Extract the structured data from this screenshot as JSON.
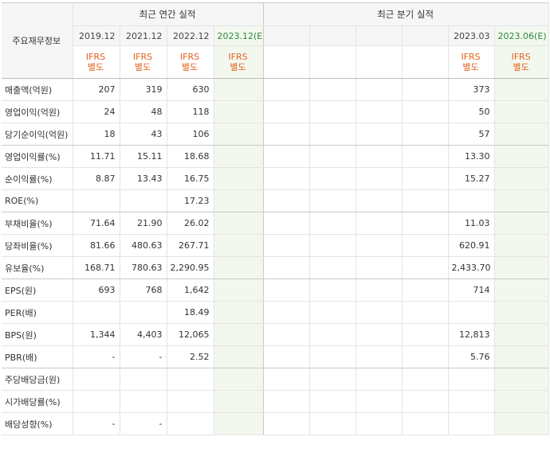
{
  "header": {
    "corner_label": "주요재무정보",
    "annual_title": "최근 연간 실적",
    "quarter_title": "최근 분기 실적",
    "annual_periods": [
      {
        "period": "2019.12",
        "basis_line1": "IFRS",
        "basis_line2": "별도"
      },
      {
        "period": "2021.12",
        "basis_line1": "IFRS",
        "basis_line2": "별도"
      },
      {
        "period": "2022.12",
        "basis_line1": "IFRS",
        "basis_line2": "별도"
      },
      {
        "period": "2023.12(E)",
        "basis_line1": "IFRS",
        "basis_line2": "별도"
      }
    ],
    "quarter_periods": [
      {
        "period": "",
        "basis_line1": "",
        "basis_line2": ""
      },
      {
        "period": "",
        "basis_line1": "",
        "basis_line2": ""
      },
      {
        "period": "",
        "basis_line1": "",
        "basis_line2": ""
      },
      {
        "period": "",
        "basis_line1": "",
        "basis_line2": ""
      },
      {
        "period": "2023.03",
        "basis_line1": "IFRS",
        "basis_line2": "별도"
      },
      {
        "period": "2023.06(E)",
        "basis_line1": "IFRS",
        "basis_line2": "별도"
      }
    ]
  },
  "rows": [
    {
      "label": "매출액(억원)",
      "annual": [
        "207",
        "319",
        "630",
        ""
      ],
      "quarter": [
        "",
        "",
        "",
        "",
        "373",
        ""
      ]
    },
    {
      "label": "영업이익(억원)",
      "annual": [
        "24",
        "48",
        "118",
        ""
      ],
      "quarter": [
        "",
        "",
        "",
        "",
        "50",
        ""
      ]
    },
    {
      "label": "당기순이익(억원)",
      "annual": [
        "18",
        "43",
        "106",
        ""
      ],
      "quarter": [
        "",
        "",
        "",
        "",
        "57",
        ""
      ]
    },
    {
      "label": "영업이익률(%)",
      "annual": [
        "11.71",
        "15.11",
        "18.68",
        ""
      ],
      "quarter": [
        "",
        "",
        "",
        "",
        "13.30",
        ""
      ]
    },
    {
      "label": "순이익률(%)",
      "annual": [
        "8.87",
        "13.43",
        "16.75",
        ""
      ],
      "quarter": [
        "",
        "",
        "",
        "",
        "15.27",
        ""
      ]
    },
    {
      "label": "ROE(%)",
      "annual": [
        "",
        "",
        "17.23",
        ""
      ],
      "quarter": [
        "",
        "",
        "",
        "",
        "",
        ""
      ]
    },
    {
      "label": "부채비율(%)",
      "annual": [
        "71.64",
        "21.90",
        "26.02",
        ""
      ],
      "quarter": [
        "",
        "",
        "",
        "",
        "11.03",
        ""
      ]
    },
    {
      "label": "당좌비율(%)",
      "annual": [
        "81.66",
        "480.63",
        "267.71",
        ""
      ],
      "quarter": [
        "",
        "",
        "",
        "",
        "620.91",
        ""
      ]
    },
    {
      "label": "유보율(%)",
      "annual": [
        "168.71",
        "780.63",
        "2,290.95",
        ""
      ],
      "quarter": [
        "",
        "",
        "",
        "",
        "2,433.70",
        ""
      ]
    },
    {
      "label": "EPS(원)",
      "annual": [
        "693",
        "768",
        "1,642",
        ""
      ],
      "quarter": [
        "",
        "",
        "",
        "",
        "714",
        ""
      ]
    },
    {
      "label": "PER(배)",
      "annual": [
        "",
        "",
        "18.49",
        ""
      ],
      "quarter": [
        "",
        "",
        "",
        "",
        "",
        ""
      ]
    },
    {
      "label": "BPS(원)",
      "annual": [
        "1,344",
        "4,403",
        "12,065",
        ""
      ],
      "quarter": [
        "",
        "",
        "",
        "",
        "12,813",
        ""
      ]
    },
    {
      "label": "PBR(배)",
      "annual": [
        "-",
        "-",
        "2.52",
        ""
      ],
      "quarter": [
        "",
        "",
        "",
        "",
        "5.76",
        ""
      ]
    },
    {
      "label": "주당배당금(원)",
      "annual": [
        "",
        "",
        "",
        ""
      ],
      "quarter": [
        "",
        "",
        "",
        "",
        "",
        ""
      ]
    },
    {
      "label": "시가배당률(%)",
      "annual": [
        "",
        "",
        "",
        ""
      ],
      "quarter": [
        "",
        "",
        "",
        "",
        "",
        ""
      ]
    },
    {
      "label": "배당성향(%)",
      "annual": [
        "-",
        "-",
        "",
        ""
      ],
      "quarter": [
        "",
        "",
        "",
        "",
        "",
        ""
      ]
    }
  ]
}
